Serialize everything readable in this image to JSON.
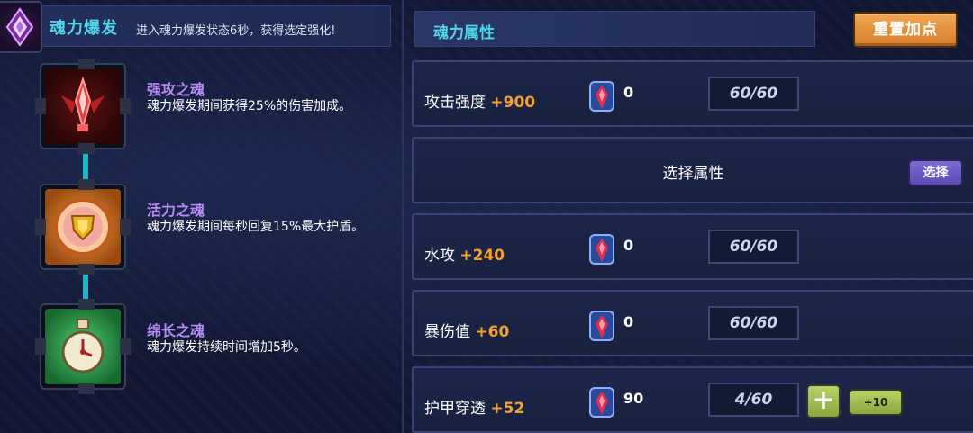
{
  "soul_burst": {
    "title": "魂力爆发",
    "description": "进入魂力爆发状态6秒，获得选定强化!"
  },
  "souls": [
    {
      "name": "强攻之魂",
      "description": "魂力爆发期间获得25%的伤害加成。",
      "icon": "red-spike-icon"
    },
    {
      "name": "活力之魂",
      "description": "魂力爆发期间每秒回复15%最大护盾。",
      "icon": "shield-orb-icon"
    },
    {
      "name": "绵长之魂",
      "description": "魂力爆发持续时间增加5秒。",
      "icon": "clock-potion-icon"
    }
  ],
  "attributes": {
    "title": "魂力属性",
    "reset_label": "重置加点",
    "rows": [
      {
        "label": "攻击强度",
        "bonus": "+900",
        "gem_count": "0",
        "level": "60/60"
      },
      {
        "select_label": "选择属性",
        "select_button": "选择"
      },
      {
        "label": "水攻",
        "bonus": "+240",
        "gem_count": "0",
        "level": "60/60"
      },
      {
        "label": "暴伤值",
        "bonus": "+60",
        "gem_count": "0",
        "level": "60/60"
      },
      {
        "label": "护甲穿透",
        "bonus": "+52",
        "gem_count": "90",
        "level": "4/60",
        "plus_label": "+",
        "plus10_label": "+10"
      }
    ]
  },
  "colors": {
    "accent_cyan": "#4fd7e8",
    "soul_name": "#b48cf0",
    "bonus_orange": "#f5a02a",
    "reset_button": "#e8953f"
  }
}
